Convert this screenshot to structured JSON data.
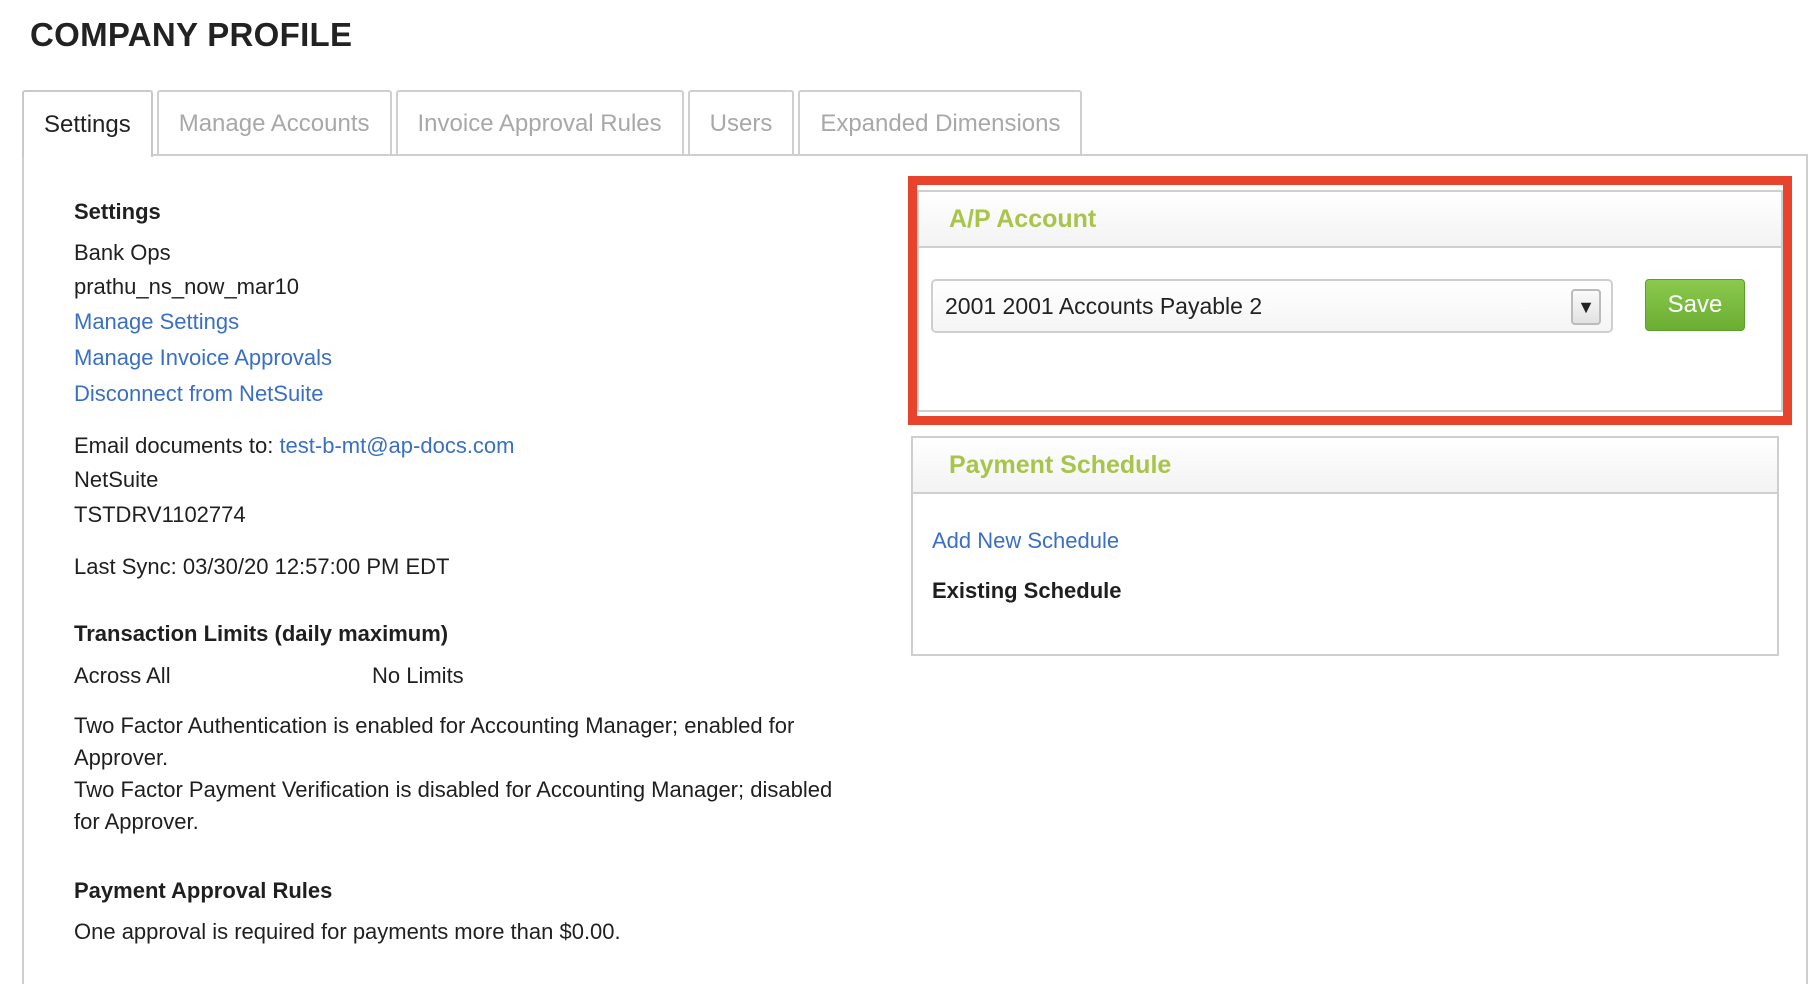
{
  "page_title": "COMPANY PROFILE",
  "tabs": [
    {
      "label": "Settings",
      "active": true
    },
    {
      "label": "Manage Accounts",
      "active": false
    },
    {
      "label": "Invoice Approval Rules",
      "active": false
    },
    {
      "label": "Users",
      "active": false
    },
    {
      "label": "Expanded Dimensions",
      "active": false
    }
  ],
  "settings": {
    "heading": "Settings",
    "company_name": "Bank Ops",
    "account_id": "prathu_ns_now_mar10",
    "links": {
      "manage_settings": "Manage Settings",
      "manage_invoice_approvals": "Manage Invoice Approvals",
      "disconnect": "Disconnect from NetSuite"
    },
    "email_label": "Email documents to: ",
    "email_value": "test-b-mt@ap-docs.com",
    "erp_name": "NetSuite",
    "erp_id": "TSTDRV1102774",
    "last_sync": "Last Sync: 03/30/20 12:57:00 PM EDT"
  },
  "transaction_limits": {
    "heading": "Transaction Limits (daily maximum)",
    "scope": "Across All",
    "value": "No Limits"
  },
  "two_factor": {
    "auth_text": "Two Factor Authentication is enabled for Accounting Manager; enabled for Approver.",
    "payment_text": "Two Factor Payment Verification is disabled for Accounting Manager; disabled for Approver."
  },
  "payment_approval": {
    "heading": "Payment Approval Rules",
    "text": "One approval is required for payments more than $0.00."
  },
  "ap_account": {
    "title": "A/P Account",
    "selected": "2001 2001 Accounts Payable 2",
    "save_label": "Save"
  },
  "payment_schedule": {
    "title": "Payment Schedule",
    "add_link": "Add New Schedule",
    "existing_label": "Existing Schedule"
  },
  "colors": {
    "accent_green": "#a9c44a",
    "link_blue": "#3a6fc4",
    "highlight_red": "#e8432c",
    "save_green": "#7aba3f"
  }
}
